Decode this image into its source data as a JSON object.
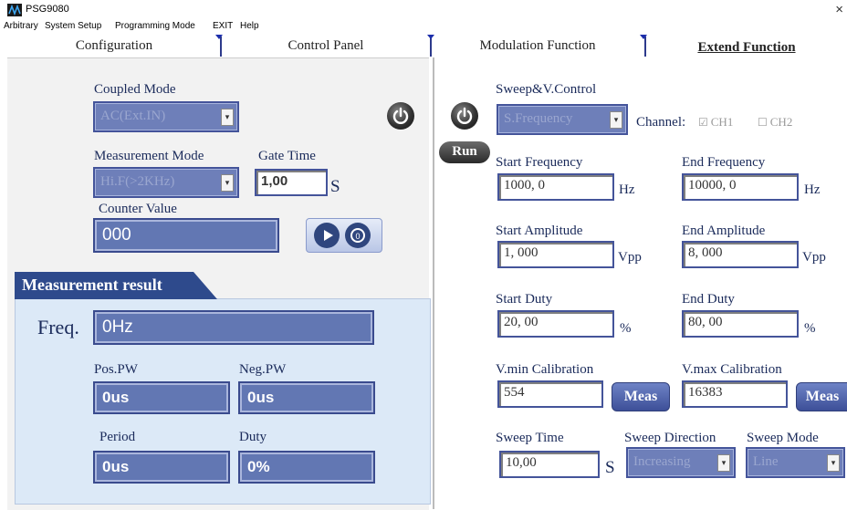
{
  "window": {
    "title": "PSG9080",
    "close_glyph": "×"
  },
  "menu": [
    "Arbitrary",
    "System Setup",
    "Programming Mode",
    "EXIT",
    "Help"
  ],
  "tabs": [
    "Configuration",
    "Control Panel",
    "Modulation Function",
    "Extend Function"
  ],
  "left": {
    "coupled_mode": {
      "label": "Coupled Mode",
      "value": "AC(Ext.IN)"
    },
    "measurement_mode": {
      "label": "Measurement Mode",
      "value": "Hi.F(>2KHz)"
    },
    "gate_time": {
      "label": "Gate Time",
      "value": "1,00",
      "unit": "S"
    },
    "counter_value": {
      "label": "Counter Value",
      "value": "000"
    },
    "result": {
      "header": "Measurement result",
      "freq_label": "Freq.",
      "freq_value": "0Hz",
      "pos_pw_label": "Pos.PW",
      "pos_pw_value": "0us",
      "neg_pw_label": "Neg.PW",
      "neg_pw_value": "0us",
      "period_label": "Period",
      "period_value": "0us",
      "duty_label": "Duty",
      "duty_value": "0%"
    }
  },
  "right": {
    "sweep_control": {
      "label": "Sweep&V.Control",
      "value": "S.Frequency"
    },
    "channel": {
      "label": "Channel:",
      "ch1": "CH1",
      "ch2": "CH2",
      "ch1_checked": true,
      "ch2_checked": false
    },
    "run_label": "Run",
    "start_frequency": {
      "label": "Start Frequency",
      "value": "1000, 0",
      "unit": "Hz"
    },
    "end_frequency": {
      "label": "End Frequency",
      "value": "10000, 0",
      "unit": "Hz"
    },
    "start_amplitude": {
      "label": "Start Amplitude",
      "value": "1, 000",
      "unit": "Vpp"
    },
    "end_amplitude": {
      "label": "End Amplitude",
      "value": "8, 000",
      "unit": "Vpp"
    },
    "start_duty": {
      "label": "Start Duty",
      "value": "20, 00",
      "unit": "%"
    },
    "end_duty": {
      "label": "End Duty",
      "value": "80, 00",
      "unit": "%"
    },
    "vmin": {
      "label": "V.min Calibration",
      "value": "554",
      "button": "Meas"
    },
    "vmax": {
      "label": "V.max Calibration",
      "value": "16383",
      "button": "Meas"
    },
    "sweep_time": {
      "label": "Sweep Time",
      "value": "10,00",
      "unit": "S"
    },
    "sweep_direction": {
      "label": "Sweep Direction",
      "value": "Increasing"
    },
    "sweep_mode": {
      "label": "Sweep Mode",
      "value": "Line"
    }
  },
  "colors": {
    "accent_blue": "#6277b3",
    "border_blue": "#3a4b8e",
    "result_panel": "#dce9f7"
  }
}
